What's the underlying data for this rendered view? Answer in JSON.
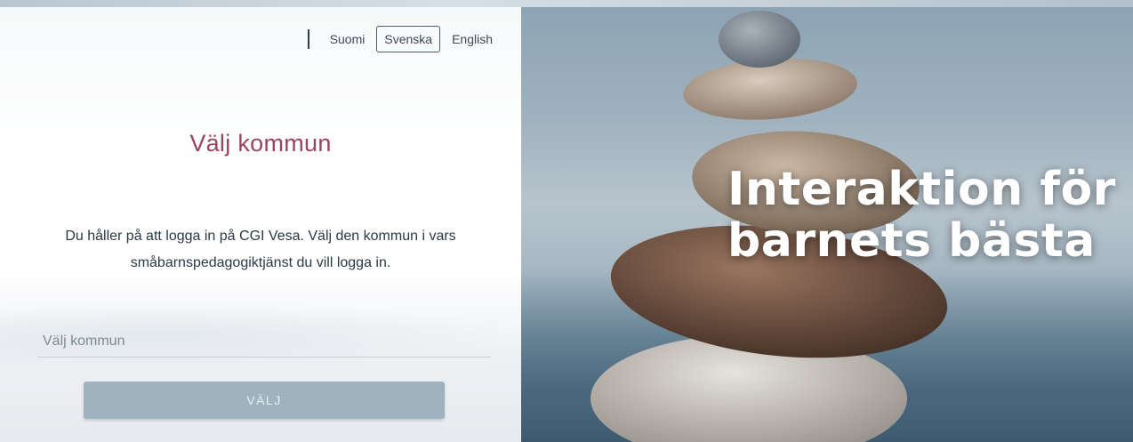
{
  "languages": [
    {
      "label": "Suomi",
      "active": false
    },
    {
      "label": "Svenska",
      "active": true
    },
    {
      "label": "English",
      "active": false
    }
  ],
  "login": {
    "title": "Välj kommun",
    "intro": "Du håller på att logga in på CGI Vesa. Välj den kommun i vars småbarnspedagogiktjänst du vill logga in.",
    "select_placeholder": "Välj kommun",
    "submit_label": "VÄLJ"
  },
  "hero": {
    "line1": "Interaktion för",
    "line2": "barnets bästa"
  },
  "colors": {
    "title_accent": "#9a4560",
    "button_bg": "#9fb3bf",
    "text_dark": "#2b3944"
  }
}
